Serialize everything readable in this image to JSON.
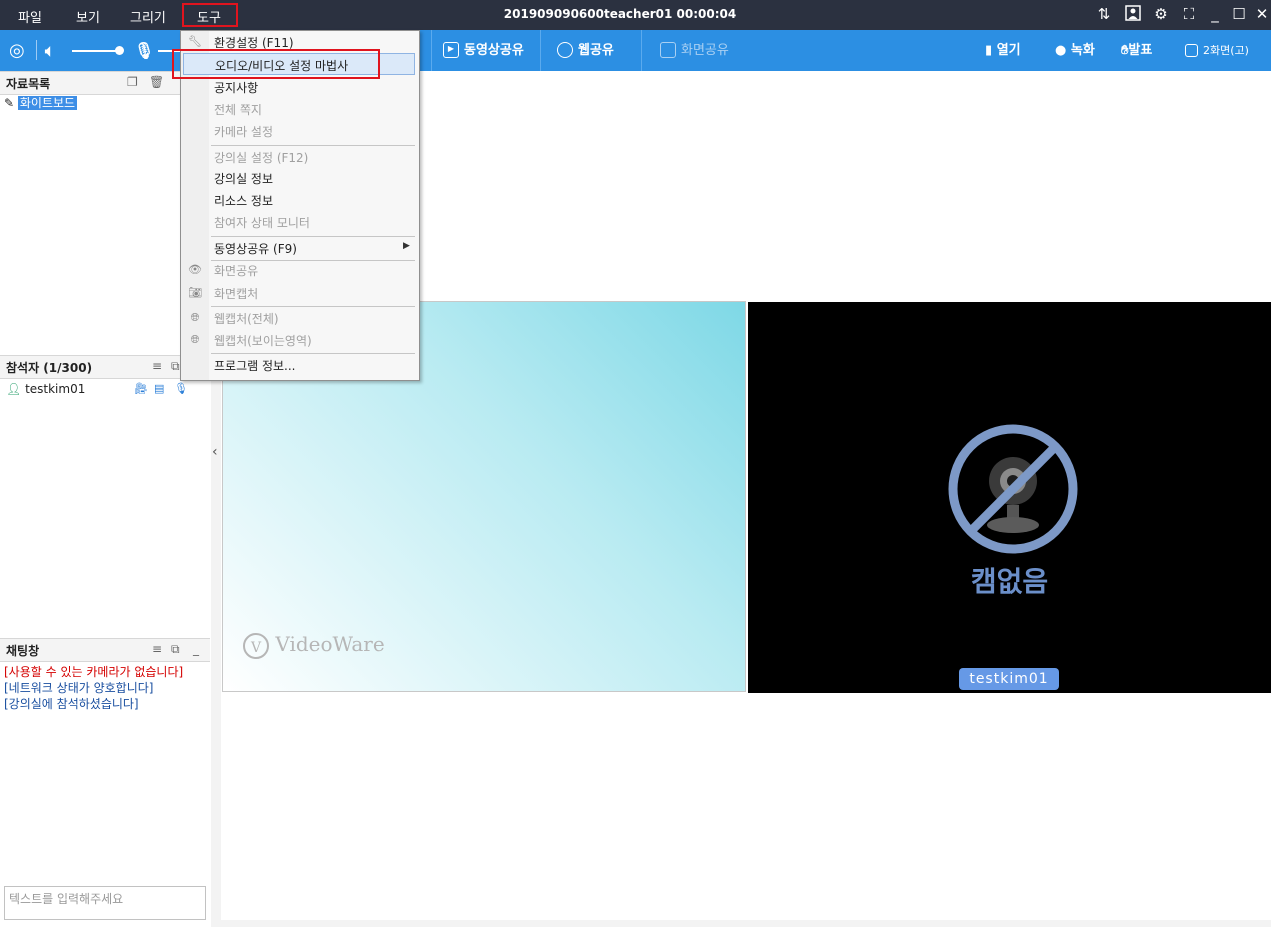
{
  "menubar": {
    "items": [
      "파일",
      "보기",
      "그리기",
      "도구"
    ],
    "title": "201909090600teacher01 00:00:04"
  },
  "toolbar": {
    "video_share": "동영상공유",
    "web_share": "웹공유",
    "screen_share": "화면공유",
    "open": "열기",
    "record": "녹화",
    "present": "발표",
    "layout": "2화면(고)"
  },
  "resources": {
    "title": "자료목록",
    "items": [
      "화이트보드"
    ]
  },
  "participants": {
    "title": "참석자 (1/300)",
    "items": [
      "testkim01"
    ]
  },
  "chat": {
    "title": "채팅창",
    "messages": [
      {
        "text": "[사용할 수 있는 카메라가 없습니다]",
        "color": "#d40000"
      },
      {
        "text": "[네트워크 상태가 양호합니다]",
        "color": "#1a4fa0"
      },
      {
        "text": "[강의실에 참석하셨습니다]",
        "color": "#1a4fa0"
      }
    ],
    "input_placeholder": "텍스트를 입력해주세요"
  },
  "stage": {
    "logo": "VideoWare",
    "no_cam_text": "캠없음",
    "cam_user": "testkim01"
  },
  "dropdown": {
    "items": [
      {
        "label": "환경설정 (F11)",
        "disabled": false,
        "icon": "wrench-icon"
      },
      {
        "label": "오디오/비디오 설정 마법사",
        "disabled": false,
        "selected": true
      },
      {
        "label": "공지사항",
        "disabled": false
      },
      {
        "label": "전체 쪽지",
        "disabled": true
      },
      {
        "label": "카메라 설정",
        "disabled": true
      },
      {
        "label": "강의실 설정 (F12)",
        "disabled": true
      },
      {
        "label": "강의실 정보",
        "disabled": false
      },
      {
        "label": "리소스 정보",
        "disabled": false
      },
      {
        "label": "참여자 상태 모니터",
        "disabled": true
      },
      {
        "label": "동영상공유 (F9)",
        "disabled": false,
        "submenu": true
      },
      {
        "label": "화면공유",
        "disabled": true,
        "icon": "screen-share-icon"
      },
      {
        "label": "화면캡처",
        "disabled": true,
        "icon": "camera-icon"
      },
      {
        "label": "웹캡처(전체)",
        "disabled": true,
        "icon": "web-capture-icon"
      },
      {
        "label": "웹캡처(보이는영역)",
        "disabled": true,
        "icon": "web-capture-icon"
      },
      {
        "label": "프로그램 정보...",
        "disabled": false
      }
    ]
  }
}
